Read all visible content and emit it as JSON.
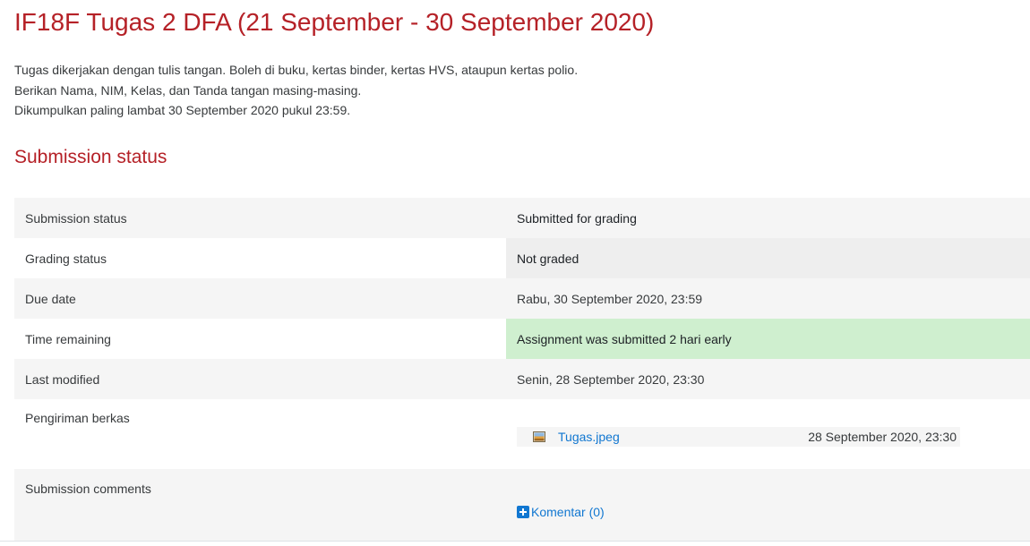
{
  "page": {
    "title": "IF18F Tugas 2 DFA (21 September - 30 September 2020)"
  },
  "intro": {
    "lines": [
      "Tugas dikerjakan dengan tulis tangan. Boleh di buku, kertas binder, kertas HVS, ataupun kertas polio.",
      "Berikan Nama, NIM, Kelas, dan Tanda tangan masing-masing.",
      "Dikumpulkan paling lambat 30 September 2020 pukul 23:59."
    ]
  },
  "submission": {
    "heading": "Submission status",
    "rows": {
      "submission_status": {
        "label": "Submission status",
        "value": "Submitted for grading"
      },
      "grading_status": {
        "label": "Grading status",
        "value": "Not graded"
      },
      "due_date": {
        "label": "Due date",
        "value": "Rabu, 30 September 2020, 23:59"
      },
      "time_remaining": {
        "label": "Time remaining",
        "value": "Assignment was submitted 2 hari early"
      },
      "last_modified": {
        "label": "Last modified",
        "value": "Senin, 28 September 2020, 23:30"
      },
      "file_submissions": {
        "label": "Pengiriman berkas",
        "files": [
          {
            "name": "Tugas.jpeg",
            "date": "28 September 2020, 23:30",
            "icon": "image-file-icon"
          }
        ]
      },
      "comments": {
        "label": "Submission comments",
        "link": "Komentar (0)",
        "icon": "plus-square-icon"
      }
    }
  },
  "colors": {
    "heading": "#b52127",
    "link": "#1177d1",
    "success_bg": "#cfefcf",
    "row_shade": "#f5f5f5",
    "text": "#373a3c"
  }
}
